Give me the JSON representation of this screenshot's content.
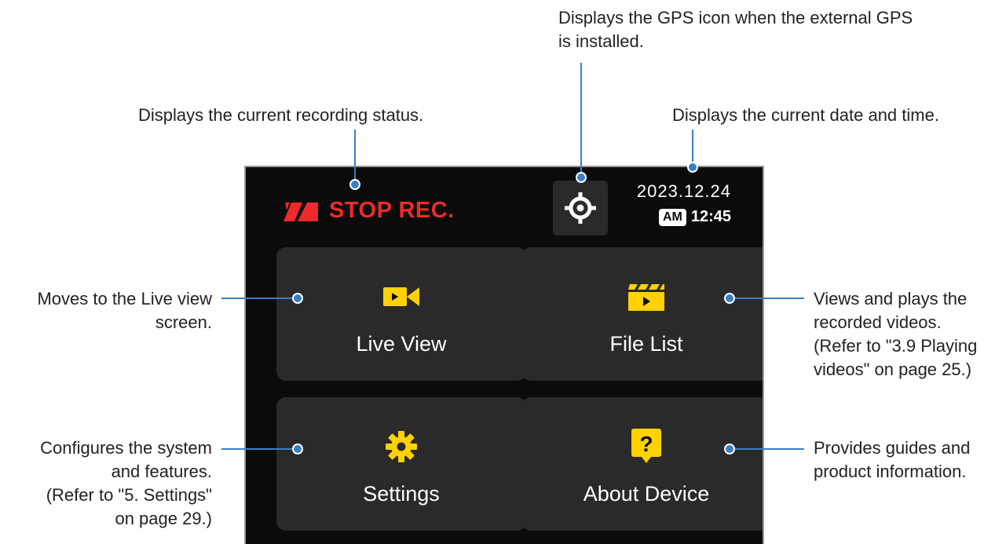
{
  "callouts": {
    "gps": [
      "Displays the GPS icon when the external GPS",
      "is installed."
    ],
    "rec_status": [
      "Displays the current recording status."
    ],
    "datetime": [
      "Displays the current date and time."
    ],
    "live_view": [
      "Moves to the Live view",
      "screen."
    ],
    "file_list": [
      "Views and plays the",
      "recorded videos.",
      "(Refer to \"3.9 Playing",
      "videos\" on page 25.)"
    ],
    "settings": [
      "Configures the system",
      "and features.",
      "(Refer to \"5. Settings\"",
      "on page 29.)"
    ],
    "about": [
      "Provides guides and",
      "product information."
    ]
  },
  "screen": {
    "status_text": "STOP REC.",
    "date": "2023.12.24",
    "ampm": "AM",
    "time": "12:45",
    "tiles": [
      {
        "label": "Live View",
        "icon": "video-camera-icon"
      },
      {
        "label": "File List",
        "icon": "clapperboard-icon"
      },
      {
        "label": "Settings",
        "icon": "gear-icon"
      },
      {
        "label": "About Device",
        "icon": "question-bubble-icon"
      }
    ]
  },
  "colors": {
    "screen_bg": "#0b0b0b",
    "tile_bg": "#2a2a2a",
    "icon_yellow": "#ffd200",
    "status_red": "#ee2a2a",
    "leader_blue": "#3b7fc4"
  }
}
